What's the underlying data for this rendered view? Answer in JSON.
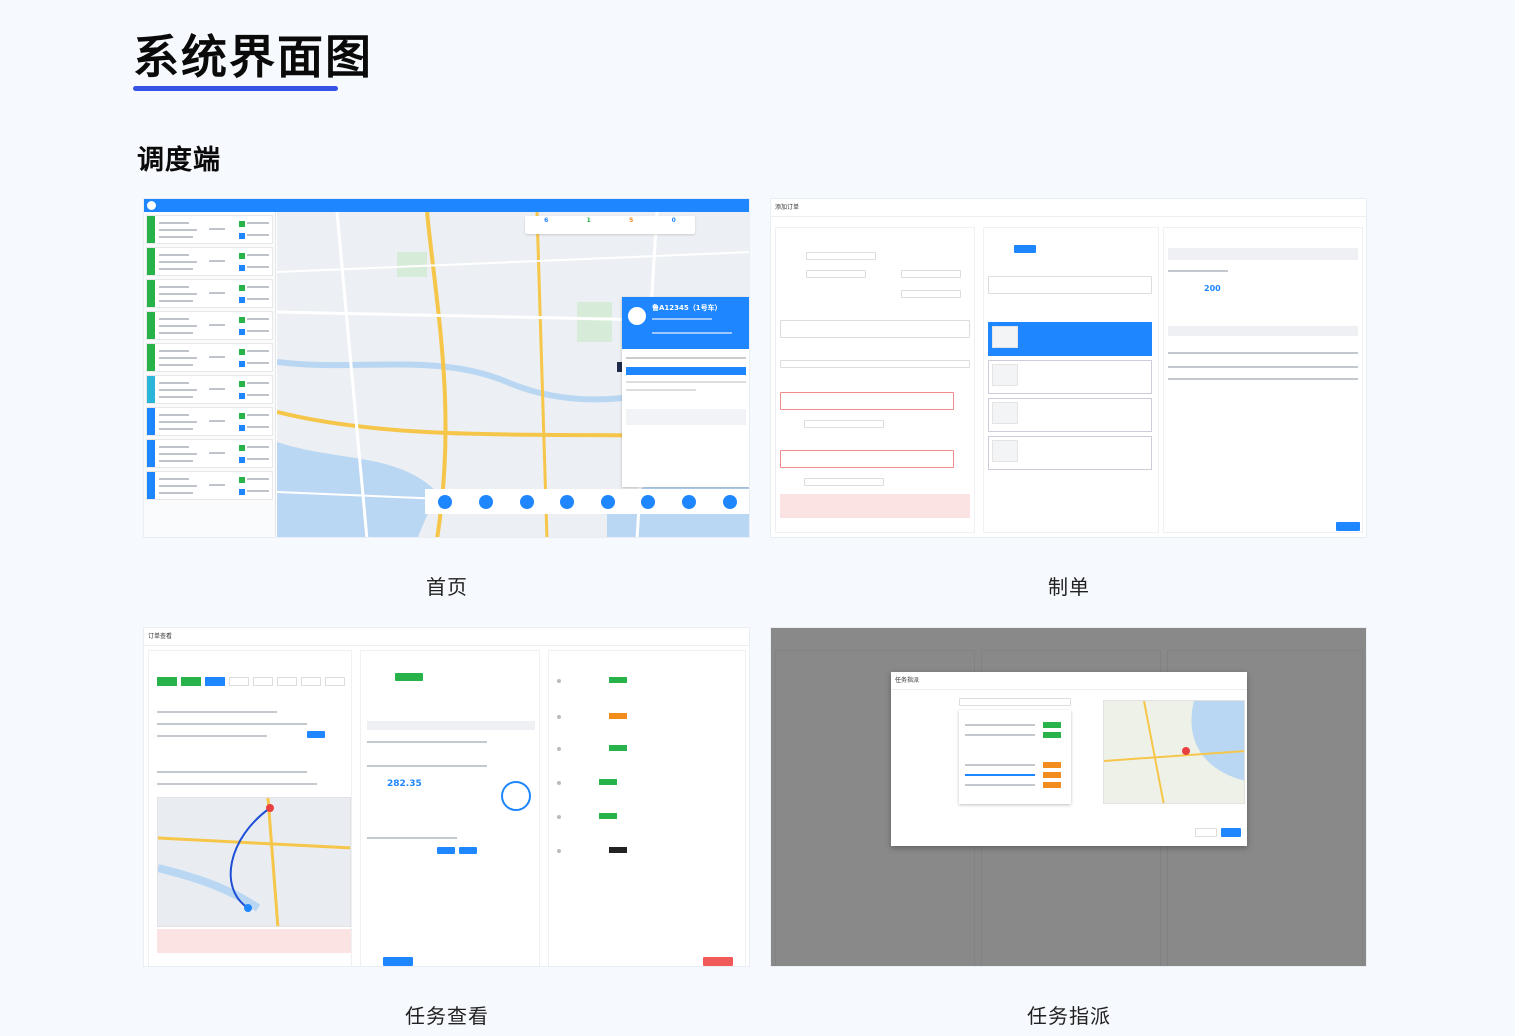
{
  "header": {
    "title": "系统界面图",
    "accent_color": "#3554e6"
  },
  "section": {
    "title": "调度端"
  },
  "screenshots": [
    {
      "caption": "首页"
    },
    {
      "caption": "制单"
    },
    {
      "caption": "任务查看"
    },
    {
      "caption": "任务指派"
    }
  ],
  "home": {
    "app_title": "",
    "stats": [
      "6",
      "1",
      "5",
      "0"
    ],
    "stat_colors": [
      "#1e86ff",
      "#27b34a",
      "#f28c1c",
      "#1e86ff"
    ],
    "order_strip_colors": [
      "#27b34a",
      "#27b34a",
      "#27b34a",
      "#27b34a",
      "#27b34a",
      "#2bb5d8",
      "#1e86ff",
      "#1e86ff",
      "#1e86ff"
    ],
    "vehicle": {
      "plate": "鲁A12345（1号车）"
    }
  },
  "form": {
    "dialog_title": "添加订单",
    "estimate": "200"
  },
  "task_view": {
    "dialog_title": "订单查看",
    "fee_total": "282.35"
  },
  "assign": {
    "modal_title": "任务指派"
  }
}
